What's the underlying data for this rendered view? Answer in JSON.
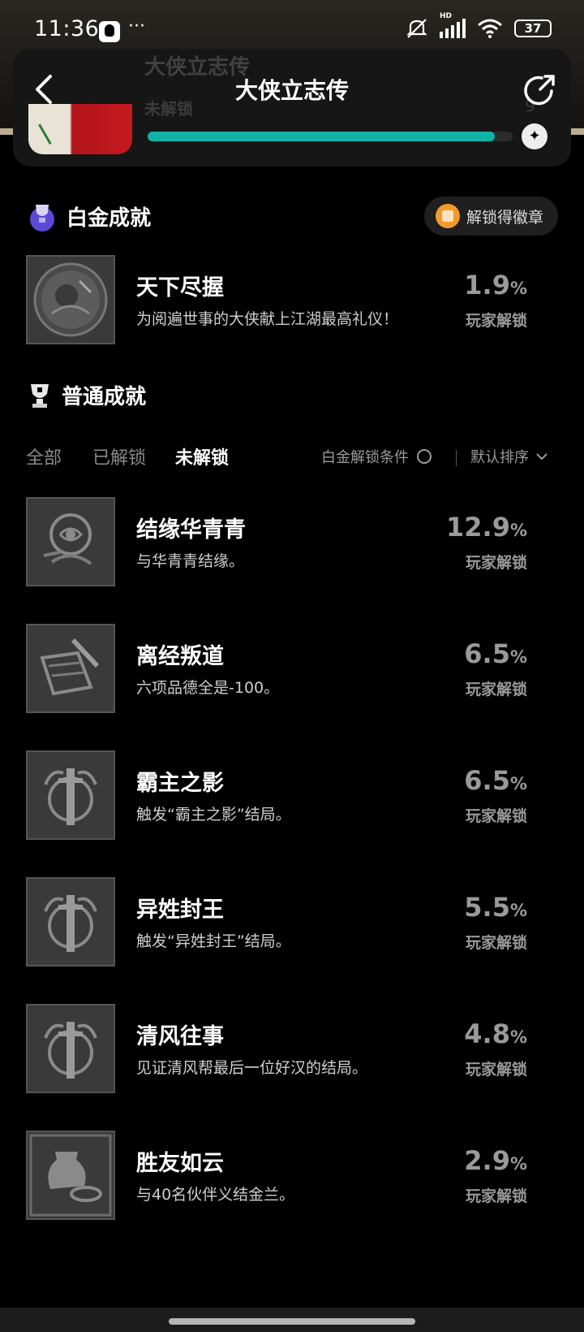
{
  "status": {
    "time": "11:36",
    "dots": "···",
    "battery": "37",
    "network_label": "HD"
  },
  "hero": {
    "ghost_title": "大侠立志传",
    "ghost_sub": "未解锁",
    "ghost_pct": "9",
    "progress": 0.95
  },
  "nav": {
    "title": "大侠立志传"
  },
  "platinum": {
    "title": "白金成就",
    "unlock_btn": "解锁得徽章",
    "item": {
      "name": "天下尽握",
      "desc": "为阅遍世事的大侠献上江湖最高礼仪！",
      "pct": "1.9",
      "pct_unit": "%",
      "pct_label": "玩家解锁"
    }
  },
  "normal": {
    "title": "普通成就",
    "tabs": [
      "全部",
      "已解锁",
      "未解锁"
    ],
    "active_tab": "未解锁",
    "condition": "白金解锁条件",
    "sort": "默认排序"
  },
  "achievements": [
    {
      "name": "结缘华青青",
      "desc": "与华青青结缘。",
      "pct": "12.9",
      "pct_unit": "%",
      "pct_label": "玩家解锁",
      "icon": "rose-icon"
    },
    {
      "name": "离经叛道",
      "desc": "六项品德全是-100。",
      "pct": "6.5",
      "pct_unit": "%",
      "pct_label": "玩家解锁",
      "icon": "scroll-sword-icon"
    },
    {
      "name": "霸主之影",
      "desc": "触发“霸主之影”结局。",
      "pct": "6.5",
      "pct_unit": "%",
      "pct_label": "玩家解锁",
      "icon": "winged-sword-icon"
    },
    {
      "name": "异姓封王",
      "desc": "触发“异姓封王”结局。",
      "pct": "5.5",
      "pct_unit": "%",
      "pct_label": "玩家解锁",
      "icon": "winged-sword-icon"
    },
    {
      "name": "清风往事",
      "desc": "见证清风帮最后一位好汉的结局。",
      "pct": "4.8",
      "pct_unit": "%",
      "pct_label": "玩家解锁",
      "icon": "winged-sword-icon"
    },
    {
      "name": "胜友如云",
      "desc": "与40名伙伴义结金兰。",
      "pct": "2.9",
      "pct_unit": "%",
      "pct_label": "玩家解锁",
      "icon": "wine-jar-icon"
    }
  ]
}
